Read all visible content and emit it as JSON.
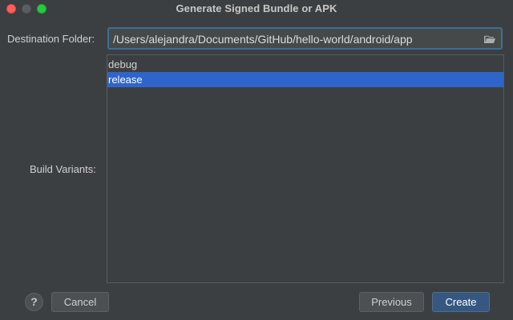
{
  "window": {
    "title": "Generate Signed Bundle or APK"
  },
  "destination": {
    "label": "Destination Folder:",
    "value": "/Users/alejandra/Documents/GitHub/hello-world/android/app",
    "browse_icon": "folder-icon"
  },
  "build_variants": {
    "label": "Build Variants:",
    "items": [
      {
        "label": "debug",
        "selected": false
      },
      {
        "label": "release",
        "selected": true
      }
    ]
  },
  "buttons": {
    "help": "?",
    "cancel": "Cancel",
    "previous": "Previous",
    "create": "Create"
  },
  "colors": {
    "background": "#3c3f41",
    "selection": "#2f65ca",
    "focus_border": "#3f6d99",
    "primary_button": "#365880"
  }
}
